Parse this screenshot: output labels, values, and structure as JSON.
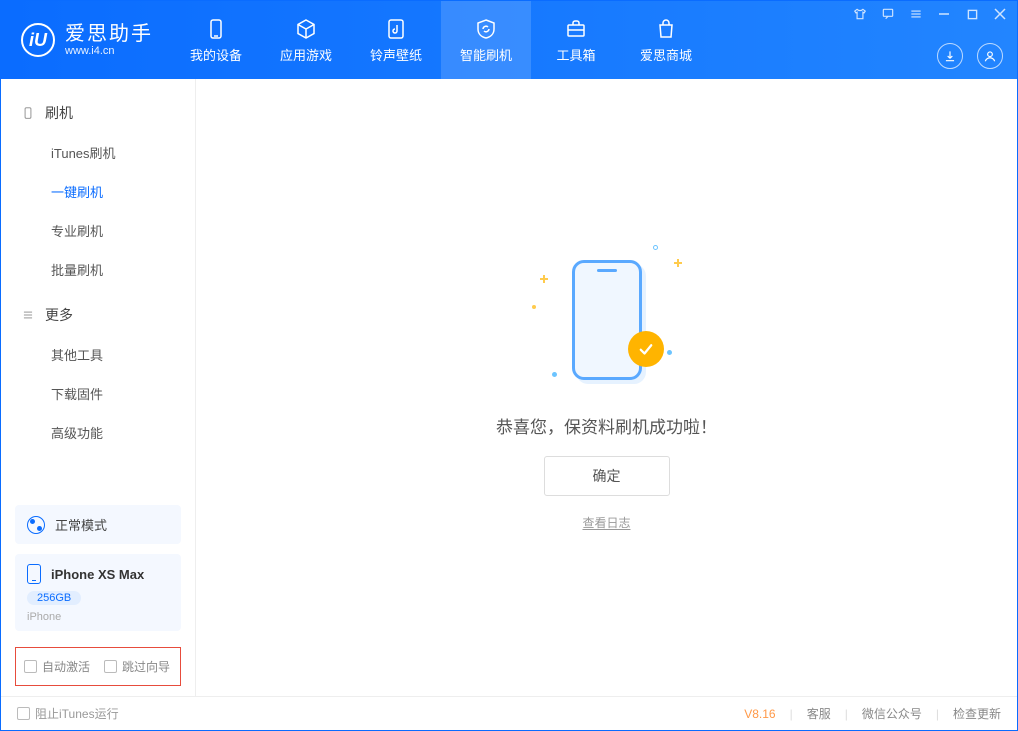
{
  "app": {
    "name": "爱思助手",
    "site": "www.i4.cn"
  },
  "tabs": {
    "device": "我的设备",
    "apps": "应用游戏",
    "ringtone": "铃声壁纸",
    "flash": "智能刷机",
    "toolbox": "工具箱",
    "store": "爱思商城"
  },
  "sidebar": {
    "section_flash": "刷机",
    "items_flash": {
      "itunes": "iTunes刷机",
      "oneclick": "一键刷机",
      "pro": "专业刷机",
      "batch": "批量刷机"
    },
    "section_more": "更多",
    "items_more": {
      "other": "其他工具",
      "firmware": "下载固件",
      "advanced": "高级功能"
    },
    "mode_label": "正常模式",
    "device_name": "iPhone XS Max",
    "device_storage": "256GB",
    "device_type": "iPhone",
    "chk_activate": "自动激活",
    "chk_skip": "跳过向导"
  },
  "main": {
    "success_text": "恭喜您，保资料刷机成功啦！",
    "ok_button": "确定",
    "view_log": "查看日志"
  },
  "footer": {
    "block_itunes": "阻止iTunes运行",
    "version": "V8.16",
    "support": "客服",
    "wechat": "微信公众号",
    "update": "检查更新"
  }
}
